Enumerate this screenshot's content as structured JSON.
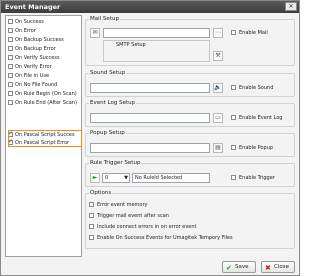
{
  "window": {
    "title": "Event Manager",
    "close_glyph": "✕"
  },
  "events": [
    {
      "label": "On Success",
      "checked": false
    },
    {
      "label": "On Error",
      "checked": false
    },
    {
      "label": "On Backup Success",
      "checked": false
    },
    {
      "label": "On Backup Error",
      "checked": false
    },
    {
      "label": "On Verify Success",
      "checked": false
    },
    {
      "label": "On Verify Error",
      "checked": false
    },
    {
      "label": "On File in Use",
      "checked": false
    },
    {
      "label": "On No File Found",
      "checked": false
    },
    {
      "label": "On Rule Begin (On Scan)",
      "checked": false
    },
    {
      "label": "On Rule End (After Scan)",
      "checked": false
    },
    {
      "label": "On Pascal Script Succes",
      "checked": true
    },
    {
      "label": "On Pascal Script Error",
      "checked": true
    }
  ],
  "mail": {
    "group_label": "Mail Setup",
    "smtp_label": "SMTP Setup",
    "enable_label": "Enable Mail"
  },
  "sound": {
    "group_label": "Sound Setup",
    "enable_label": "Enable Sound"
  },
  "eventlog": {
    "group_label": "Event Log Setup",
    "enable_label": "Enable Event Log"
  },
  "popup": {
    "group_label": "Popup Setup",
    "enable_label": "Enable Popup"
  },
  "trigger": {
    "group_label": "Rule Trigger Setup",
    "rule_value": "0",
    "rule_selected": "No RuleId Selected",
    "enable_label": "Enable Trigger"
  },
  "options": {
    "group_label": "Options",
    "items": [
      "Error event memory",
      "Trigger mail event after scan",
      "Include connect errors in on error event",
      "Enable On Success Events for Umagitek Tempory Files"
    ]
  },
  "buttons": {
    "save": "Save",
    "close": "Close"
  },
  "icons": {
    "mail": "envelope-icon",
    "smtp": "wrench-icon",
    "sound": "speaker-icon",
    "eventlog": "log-window-icon",
    "popup": "popup-window-icon",
    "trigger": "play-icon"
  },
  "colors": {
    "highlight": "#f08a1a",
    "title_bar": "#4a4a4a",
    "check": "#1a3fb0"
  }
}
